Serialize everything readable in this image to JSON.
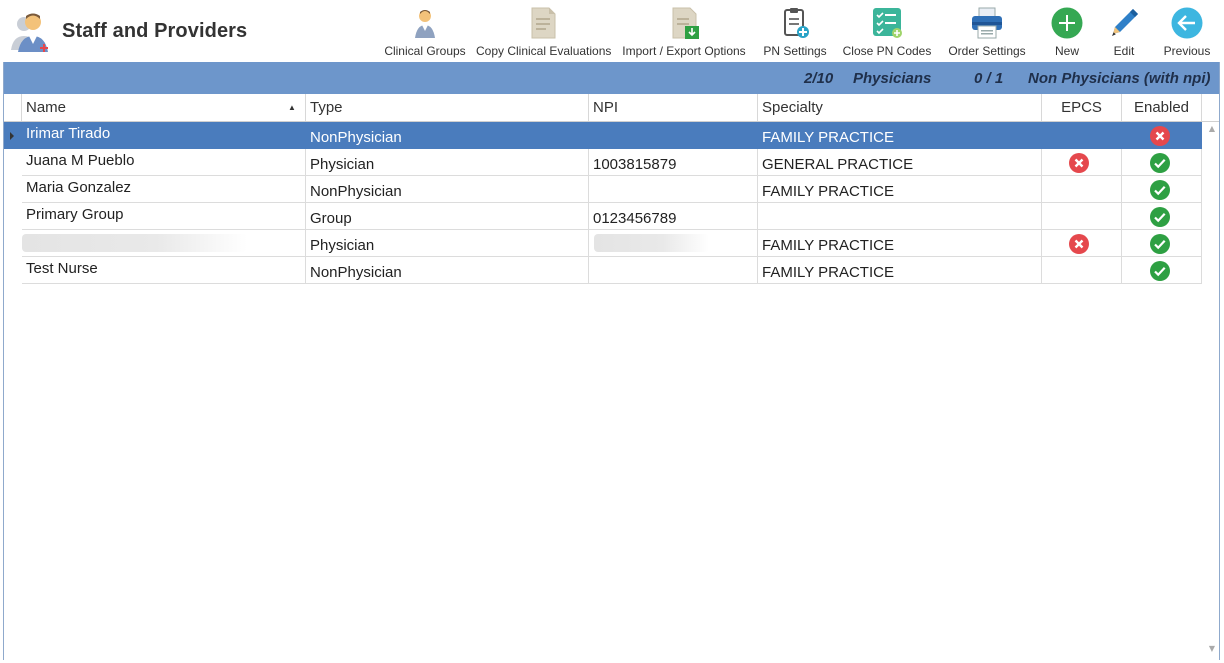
{
  "app": {
    "title": "Staff and Providers"
  },
  "toolbar": [
    {
      "name": "clinical-groups-button",
      "icon": "clinical-groups-icon",
      "label": "Clinical Groups"
    },
    {
      "name": "copy-clinical-evaluations-button",
      "icon": "document-icon",
      "label": "Copy Clinical Evaluations"
    },
    {
      "name": "import-export-options-button",
      "icon": "import-export-icon",
      "label": "Import / Export Options"
    },
    {
      "name": "pn-settings-button",
      "icon": "clipboard-add-icon",
      "label": "PN Settings"
    },
    {
      "name": "close-pn-codes-button",
      "icon": "checklist-icon",
      "label": "Close PN Codes"
    },
    {
      "name": "order-settings-button",
      "icon": "printer-icon",
      "label": "Order Settings"
    },
    {
      "name": "new-button",
      "icon": "plus-icon",
      "label": "New"
    },
    {
      "name": "edit-button",
      "icon": "pencil-icon",
      "label": "Edit"
    },
    {
      "name": "previous-button",
      "icon": "back-arrow-icon",
      "label": "Previous"
    }
  ],
  "summary": {
    "physicians_count": "2/10",
    "physicians_label": "Physicians",
    "non_physicians_count": "0 / 1",
    "non_physicians_label": "Non Physicians (with npi)"
  },
  "grid": {
    "columns": [
      "Name",
      "Type",
      "NPI",
      "Specialty",
      "EPCS",
      "Enabled"
    ],
    "rows": [
      {
        "name": "Irimar Tirado",
        "type": "NonPhysician",
        "npi": "",
        "specialty": "FAMILY PRACTICE",
        "epcs": "",
        "enabled": "no"
      },
      {
        "name": "Juana M Pueblo",
        "type": "Physician",
        "npi": "1003815879",
        "specialty": "GENERAL PRACTICE",
        "epcs": "no",
        "enabled": "yes"
      },
      {
        "name": "Maria Gonzalez",
        "type": "NonPhysician",
        "npi": "",
        "specialty": "FAMILY PRACTICE",
        "epcs": "",
        "enabled": "yes"
      },
      {
        "name": "Primary Group",
        "type": "Group",
        "npi": "0123456789",
        "specialty": "",
        "epcs": "",
        "enabled": "yes"
      },
      {
        "name": "",
        "type": "Physician",
        "npi": "",
        "specialty": "FAMILY PRACTICE",
        "epcs": "no",
        "enabled": "yes"
      },
      {
        "name": "Test Nurse",
        "type": "NonPhysician",
        "npi": "",
        "specialty": "FAMILY PRACTICE",
        "epcs": "",
        "enabled": "yes"
      }
    ]
  },
  "colors": {
    "accent": "#6d96cb",
    "selected": "#4a7cbd",
    "yes": "#2ea043",
    "no": "#e5484d"
  }
}
